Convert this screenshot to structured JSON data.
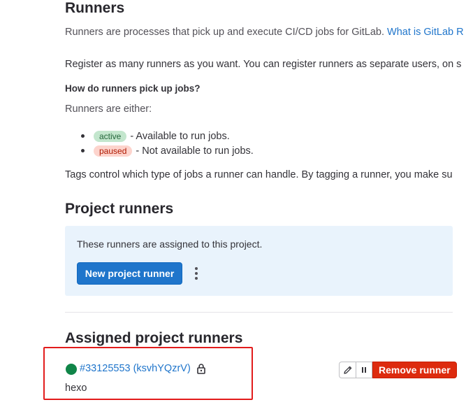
{
  "runners_section": {
    "title": "Runners",
    "description": "Runners are processes that pick up and execute CI/CD jobs for GitLab.",
    "description_link": "What is GitLab R",
    "register_text": "Register as many runners as you want. You can register runners as separate users, on s",
    "how_heading": "How do runners pick up jobs?",
    "either_text": "Runners are either:",
    "states": [
      {
        "badge": "active",
        "text": "- Available to run jobs."
      },
      {
        "badge": "paused",
        "text": "- Not available to run jobs."
      }
    ],
    "tags_text": "Tags control which type of jobs a runner can handle. By tagging a runner, you make su"
  },
  "project_runners": {
    "title": "Project runners",
    "info_text": "These runners are assigned to this project.",
    "new_button": "New project runner",
    "more_icon": "vertical-ellipsis-icon"
  },
  "assigned": {
    "title": "Assigned project runners",
    "runner": {
      "status_color": "#108548",
      "link_text": "#33125553 (ksvhYQzrV)",
      "lock_icon": "lock-icon",
      "tag": "hexo"
    },
    "actions": {
      "edit_icon": "pencil-icon",
      "pause_icon": "pause-icon",
      "remove_label": "Remove runner"
    }
  },
  "colors": {
    "link": "#1f75cb",
    "primary_button": "#1f75cb",
    "danger_button": "#dd2b0e",
    "info_bg": "#e9f3fc",
    "annotation_border": "#e21c1c"
  }
}
